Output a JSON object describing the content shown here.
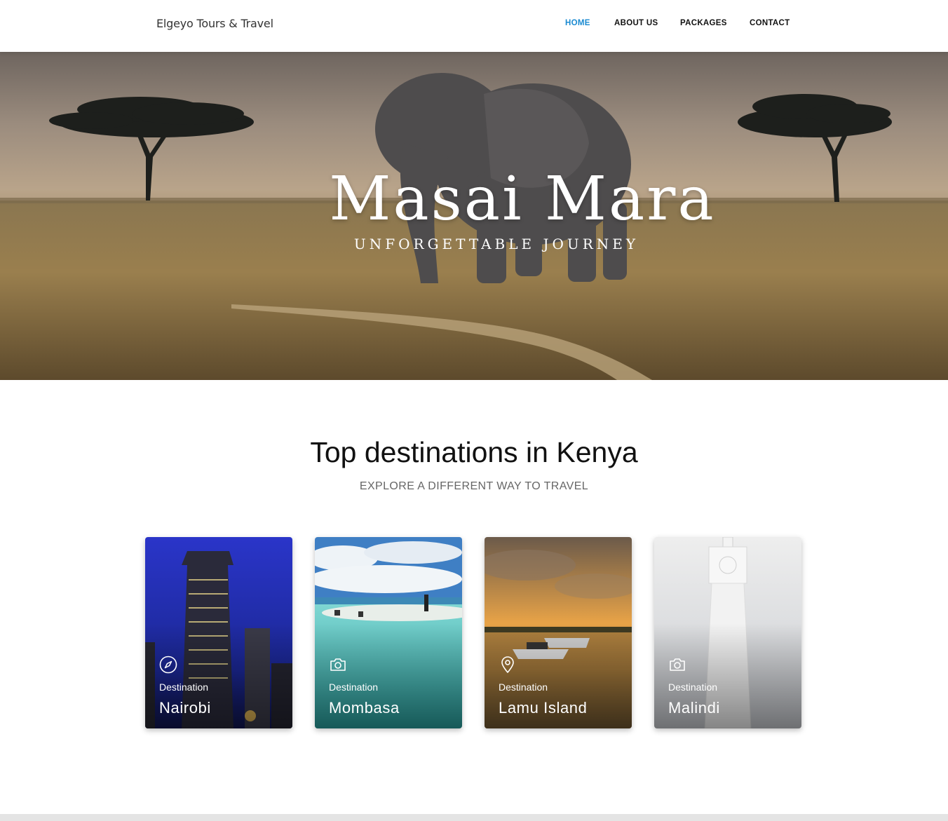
{
  "header": {
    "brand": "Elgeyo Tours & Travel",
    "nav": [
      {
        "label": "HOME",
        "active": true
      },
      {
        "label": "ABOUT US",
        "active": false
      },
      {
        "label": "PACKAGES",
        "active": false
      },
      {
        "label": "CONTACT",
        "active": false
      }
    ],
    "accent_color": "#1a8ad1"
  },
  "hero": {
    "title": "Masai Mara",
    "subtitle": "UNFORGETTABLE JOURNEY"
  },
  "destinations": {
    "title": "Top destinations in Kenya",
    "subtitle": "EXPLORE A DIFFERENT WAY TO TRAVEL",
    "cards": [
      {
        "label": "Destination",
        "name": "Nairobi",
        "icon": "compass-icon"
      },
      {
        "label": "Destination",
        "name": "Mombasa",
        "icon": "camera-icon"
      },
      {
        "label": "Destination",
        "name": "Lamu Island",
        "icon": "map-pin-icon"
      },
      {
        "label": "Destination",
        "name": "Malindi",
        "icon": "camera-icon"
      }
    ]
  }
}
